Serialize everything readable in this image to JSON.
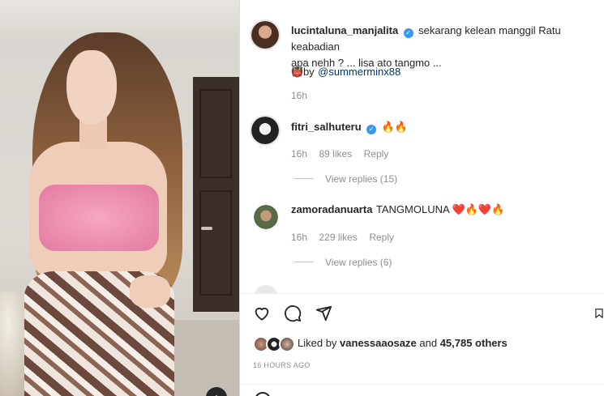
{
  "post": {
    "author": "lucintaluna_manjalita",
    "caption_line1": "sekarang kelean manggil Ratu keabadian",
    "caption_line2": "apa nehh ? ... lisa ato tangmo ...",
    "credit_prefix": "by",
    "credit_user": "@summerminx88",
    "time": "16h"
  },
  "comments": [
    {
      "user": "fitri_salhuteru",
      "text": "🔥🔥",
      "time": "16h",
      "likes": "89 likes",
      "reply_label": "Reply",
      "view_replies": "View replies (15)"
    },
    {
      "user": "zamoradanuarta",
      "text": "TANGMOLUNA ❤️🔥❤️🔥",
      "time": "16h",
      "likes": "229 likes",
      "reply_label": "Reply",
      "view_replies": "View replies (6)"
    }
  ],
  "liked_by": {
    "prefix": "Liked by",
    "user": "vanessaaosaze",
    "middle": "and",
    "count": "45,785 others"
  },
  "timestamp": "16 HOURS AGO",
  "icons": {
    "like": "heart-icon",
    "comment": "comment-bubble-icon",
    "share": "paper-plane-icon",
    "save": "bookmark-icon",
    "mute": "mute-icon"
  },
  "colors": {
    "verified": "#3897f0",
    "muted_text": "#8e8e8e",
    "text": "#262626",
    "border": "#dbdbdb"
  }
}
